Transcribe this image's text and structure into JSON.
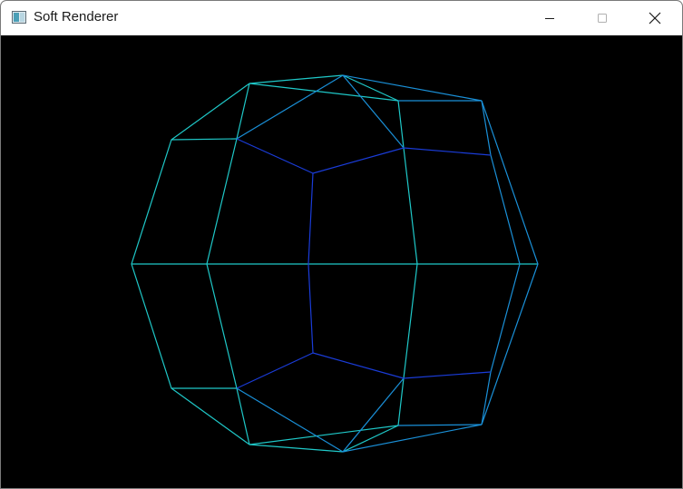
{
  "window": {
    "title": "Soft Renderer"
  },
  "titlebar": {
    "app_icon": "window-app-icon",
    "minimize_icon": "minimize-icon",
    "maximize_icon": "maximize-icon",
    "close_icon": "close-icon"
  },
  "viewport": {
    "background": "#000000",
    "content": "wireframe-mesh",
    "colors": {
      "outer_edges": "#1fc8c8",
      "mid_edges": "#1a90d8",
      "inner_edges": "#1a3cd8"
    }
  }
}
